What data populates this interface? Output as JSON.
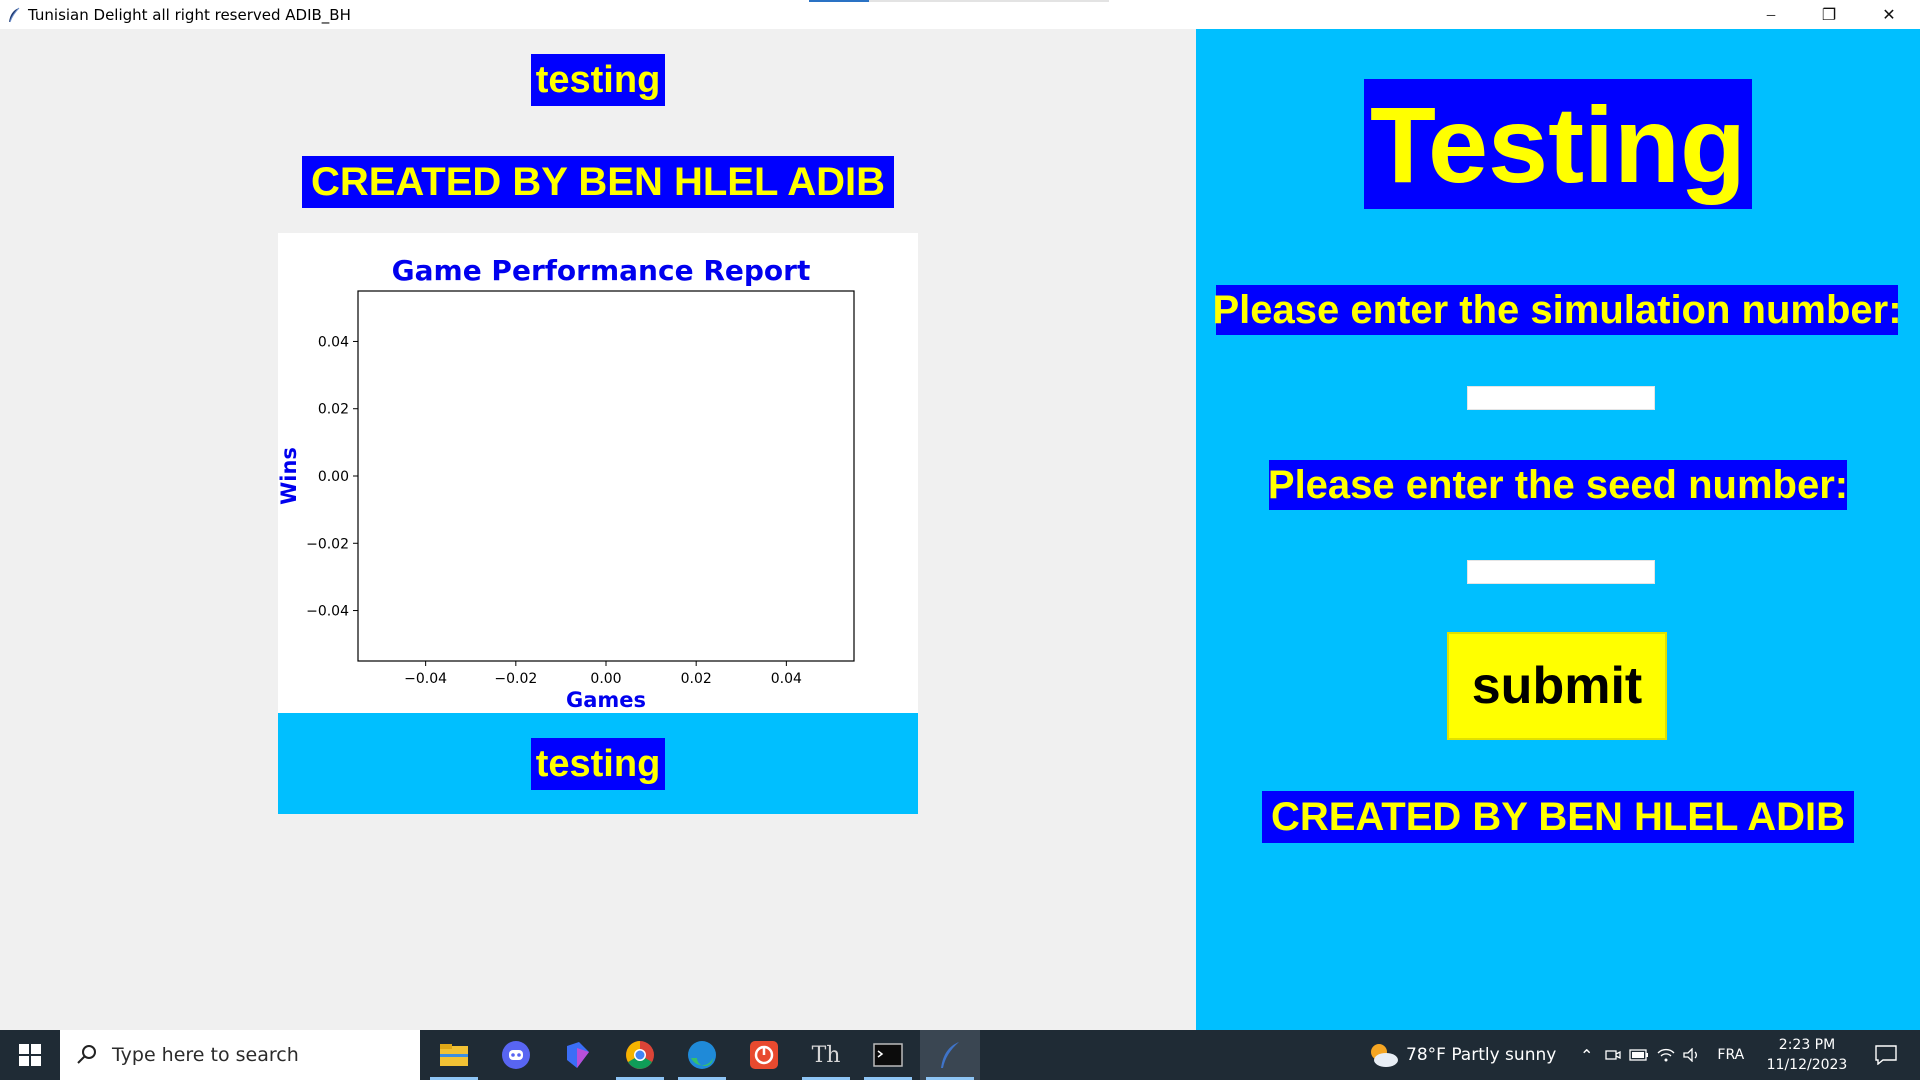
{
  "window": {
    "title": "Tunisian Delight all right reserved ADIB_BH",
    "minimize_glyph": "─",
    "restore_glyph": "❐",
    "close_glyph": "✕"
  },
  "left_panel": {
    "top_label": "testing",
    "credit_label": "CREATED BY BEN HLEL ADIB",
    "bottom_label": "testing"
  },
  "chart_data": {
    "type": "line",
    "title": "Game Performance Report",
    "xlabel": "Games",
    "ylabel": "Wins",
    "x_ticks": [
      "−0.04",
      "−0.02",
      "0.00",
      "0.02",
      "0.04"
    ],
    "y_ticks": [
      "0.04",
      "0.02",
      "0.00",
      "−0.02",
      "−0.04"
    ],
    "xlim": [
      -0.055,
      0.055
    ],
    "ylim": [
      -0.055,
      0.055
    ],
    "series": [],
    "grid": false,
    "label_color": "#0000ee"
  },
  "right_panel": {
    "heading": "Testing",
    "simulation_prompt": "Please enter the simulation number:",
    "simulation_value": "",
    "seed_prompt": "Please enter the seed number:",
    "seed_value": "",
    "submit_label": "submit",
    "credit_label": "CREATED BY BEN HLEL ADIB"
  },
  "colors": {
    "label_bg": "#0000ff",
    "label_fg": "#ffff00",
    "panel_bg": "#00bfff",
    "submit_bg": "#ffff00"
  },
  "taskbar": {
    "search_placeholder": "Type here to search",
    "apps": [
      "file-explorer-icon",
      "discord-icon",
      "bing-icon",
      "chrome-icon",
      "edge-icon",
      "power-app-icon",
      "th-app-icon",
      "terminal-icon",
      "feather-app-icon"
    ],
    "th_app_text": "Th",
    "weather": "78°F  Partly sunny",
    "language": "FRA",
    "time": "2:23 PM",
    "date": "11/12/2023"
  }
}
